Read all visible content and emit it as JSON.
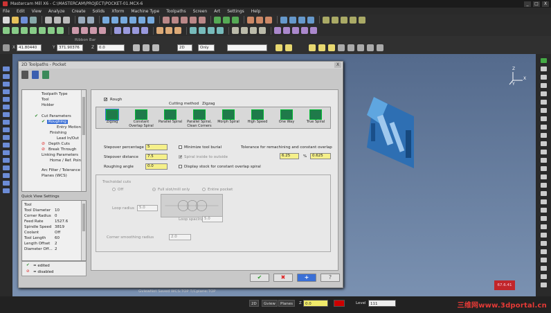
{
  "app": {
    "title": "Mastercam Mill X6 - C:\\MASTERCAM\\PROJECT\\POCKET-01.MCX-6"
  },
  "window_buttons": [
    "_",
    "□",
    "X"
  ],
  "menu": [
    "File",
    "Edit",
    "View",
    "Analyze",
    "Create",
    "Solids",
    "Xform",
    "Machine Type",
    "Toolpaths",
    "Screen",
    "Art",
    "Settings",
    "Help"
  ],
  "coords": {
    "x_value": "41.80440",
    "y_value": "371.90376",
    "z_value": "0.0",
    "x_label": "X",
    "y_label": "Y",
    "z_label": "Z",
    "ribbon_label": "Ribbon Bar",
    "mode_value": "2D",
    "only_value": "Only"
  },
  "viewport": {
    "axis_z": "Z",
    "axis_x": "X",
    "axis_y": "Y",
    "info": "GviewNot Saved    WCS:TOP    T/Cplane:TOP",
    "badge": "67.6.41"
  },
  "statusbar": {
    "mode": "2D",
    "gview": "Gview",
    "planes": "Planes",
    "z_label": "Z",
    "z_value": "0.0",
    "level_label": "Level",
    "level_value": "111"
  },
  "watermark": "三维网www.3dportal.cn",
  "dialog": {
    "title": "2D Toolpaths - Pocket",
    "close": "X",
    "tree": [
      "Toolpath Type",
      "Tool",
      "Holder",
      "Cut Parameters",
      "Roughing",
      "Entry Motion",
      "Finishing",
      "Lead In/Out",
      "Depth Cuts",
      "Break Through",
      "Linking Parameters",
      "Home / Ref. Points",
      "Arc Filter / Tolerance",
      "Planes (WCS)"
    ],
    "quick_view_title": "Quick View Settings",
    "quick_view": [
      {
        "k": "Tool",
        "v": ""
      },
      {
        "k": "Tool Diameter",
        "v": "10"
      },
      {
        "k": "Corner Radius",
        "v": "0"
      },
      {
        "k": "Feed Rate",
        "v": "1527.6"
      },
      {
        "k": "Spindle Speed",
        "v": "3819"
      },
      {
        "k": "Coolant",
        "v": "Off"
      },
      {
        "k": "Tool Length",
        "v": "60"
      },
      {
        "k": "Length Offset",
        "v": "2"
      },
      {
        "k": "Diameter Off...",
        "v": "2"
      }
    ],
    "legend": {
      "edited": "= edited",
      "disabled": "= disabled"
    },
    "rough": {
      "checkbox_label": "Rough",
      "cutting_method_label": "Cutting method",
      "cutting_method_value": "Zigzag",
      "methods": [
        "Zigzag",
        "Constant Overlap Spiral",
        "Parallel Spiral",
        "Parallel Spiral, Clean Corners",
        "Morph Spiral",
        "High Speed",
        "One Way",
        "True Spiral"
      ],
      "stepover_percentage_label": "Stepover percentage",
      "stepover_percentage_value": "5",
      "stepover_distance_label": "Stepover distance",
      "stepover_distance_value": "7.5",
      "roughing_angle_label": "Roughing angle",
      "roughing_angle_value": "0.0",
      "minimize_burial": "Minimize tool burial",
      "spiral_inside": "Spiral inside to outside",
      "display_stock": "Display stock for constant overlap spiral",
      "tolerance_label": "Tolerance for remachining and constant overlap",
      "tolerance_value1": "6.25",
      "tolerance_pct": "%",
      "tolerance_value2": "0.625"
    },
    "trochoidal": {
      "title": "Trochoidal cuts",
      "off": "Off",
      "full_slot": "Full slot/mill only",
      "entire": "Entire pocket",
      "loop_radius_label": "Loop radius",
      "loop_radius_value": "5.0",
      "loop_spacing_label": "Loop spacing",
      "loop_spacing_value": "5.0",
      "corner_smoothing_label": "Corner smoothing radius",
      "corner_smoothing_value": "2.0"
    },
    "buttons": {
      "ok": "✔",
      "cancel": "✖",
      "add": "+",
      "help": "?"
    }
  },
  "colors": {
    "accent_blue": "#3a6fd6",
    "yellow_field": "#f5f08a",
    "method_icon": "#1f7a4a",
    "viewport_top": "#546a8c",
    "viewport_bottom": "#7a91b1"
  }
}
